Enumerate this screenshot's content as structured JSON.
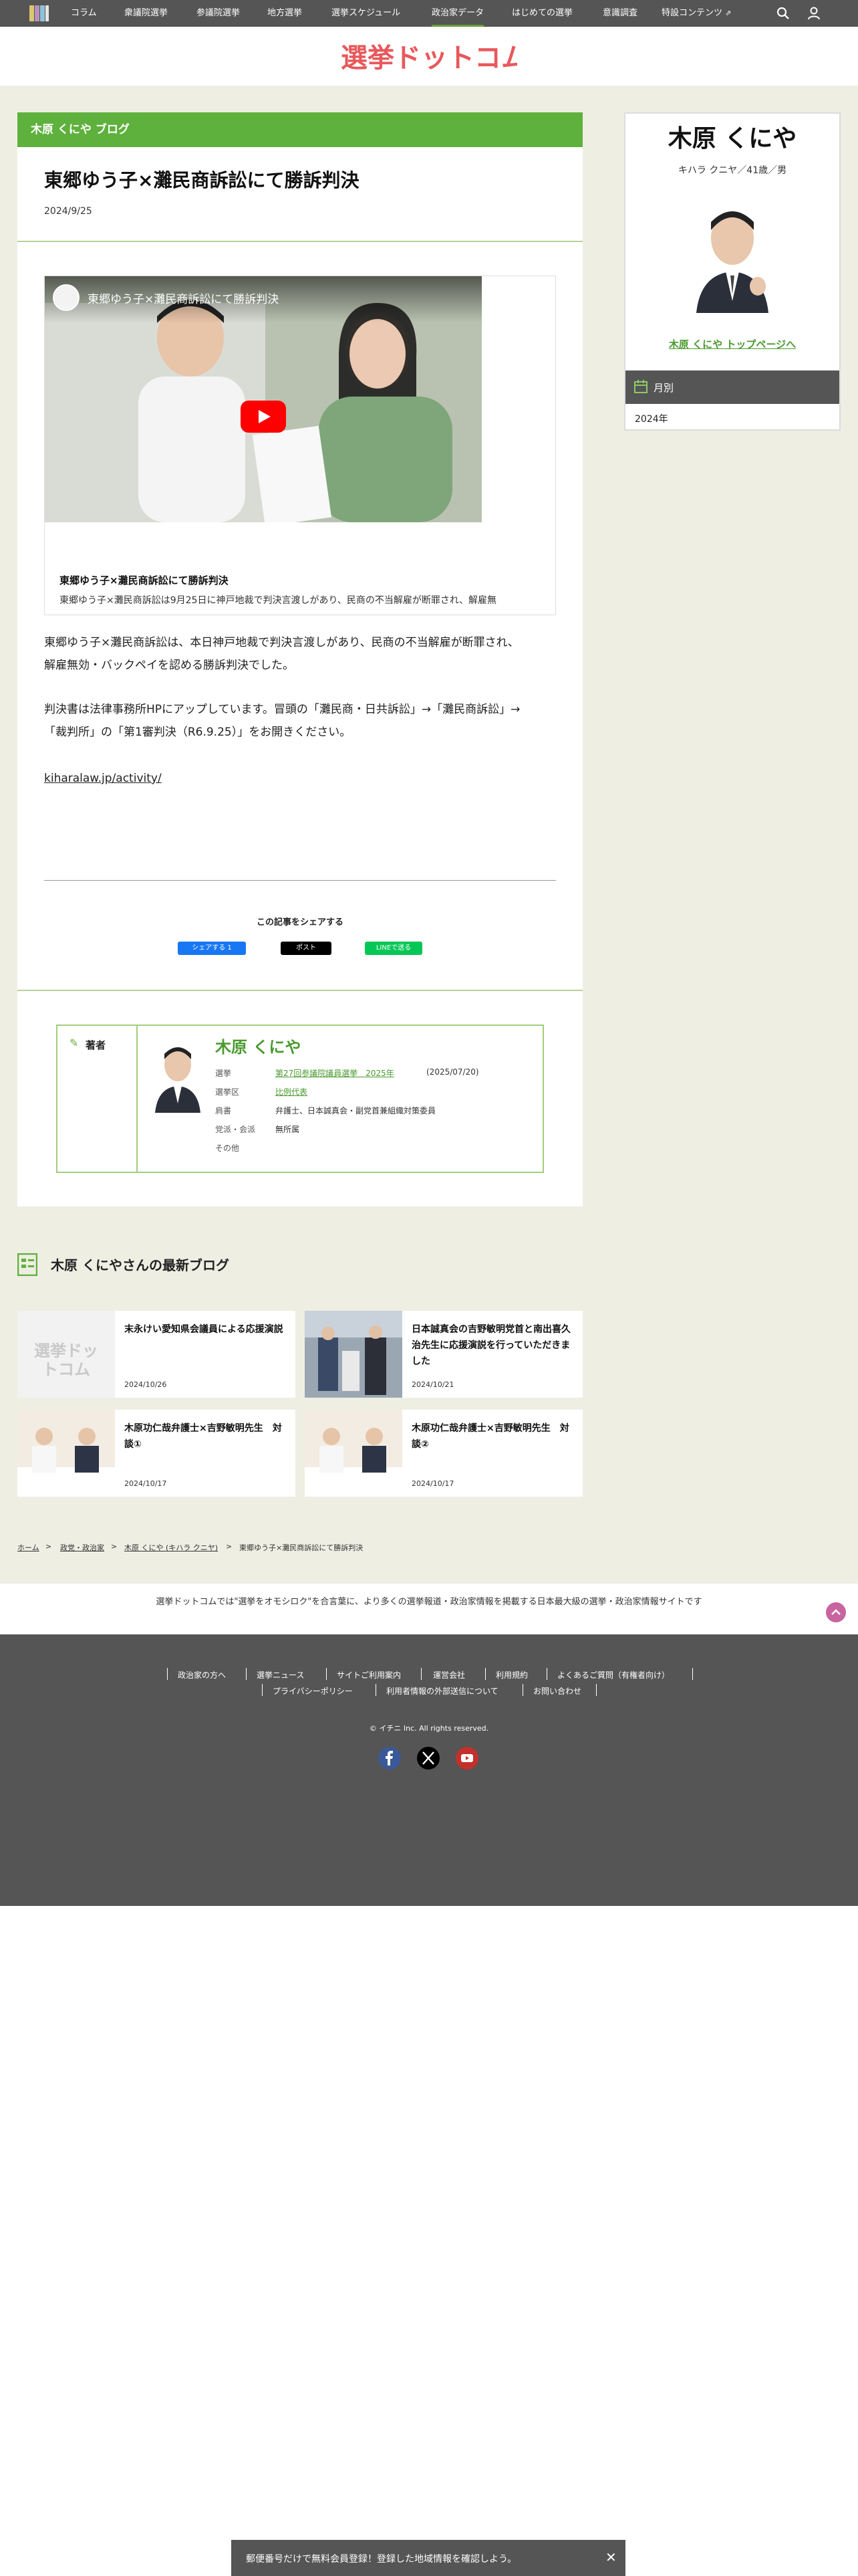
{
  "nav": {
    "items": [
      "コラム",
      "衆議院選挙",
      "参議院選挙",
      "地方選挙",
      "選挙スケジュール",
      "政治家データ",
      "はじめての選挙",
      "意識調査",
      "特設コンテンツ"
    ]
  },
  "logo": {
    "text": "選挙ドットコム"
  },
  "main": {
    "category_header": "木原 くにや ブログ",
    "title": "東郷ゆう子×灘民商訴訟にて勝訴判決",
    "date": "2024/9/25",
    "embed": {
      "video_title": "東郷ゆう子×灘民商訴訟にて勝訴判決",
      "title": "東郷ゆう子×灘民商訴訟にて勝訴判決",
      "description": "東郷ゆう子×灘民商訴訟は9月25日に神戸地裁で判決言渡しがあり、民商の不当解雇が断罪され、解雇無"
    },
    "body": [
      "東郷ゆう子×灘民商訴訟は、本日神戸地裁で判決言渡しがあり、民商の不当解雇が断罪され、",
      "解雇無効・バックペイを認める勝訴判決でした。",
      "判決書は法律事務所HPにアップしています。冒頭の「灘民商・日共訴訟」→「灘民商訴訟」→",
      "「裁判所」の「第1審判決（R6.9.25）」をお開きください。"
    ],
    "link": "kiharalaw.jp/activity/",
    "share": {
      "heading": "この記事をシェアする",
      "facebook": "シェアする 1",
      "x": "ポスト",
      "line": "LINEで送る"
    }
  },
  "author": {
    "label": "著者",
    "name": "木原 くにや",
    "rows": [
      {
        "key": "選挙",
        "value": "第27回参議院議員選挙　2025年",
        "extra": "(2025/07/20)"
      },
      {
        "key": "選挙区",
        "value": "比例代表"
      },
      {
        "key": "肩書",
        "value": "弁護士、日本誠真会・副党首兼組織対策委員"
      },
      {
        "key": "党派・会派",
        "value": "無所属"
      },
      {
        "key": "その他",
        "value": ""
      }
    ]
  },
  "recent": {
    "heading": "木原 くにやさんの最新ブログ",
    "cards": [
      {
        "title": "末永けい愛知県会議員による応援演説",
        "date": "2024/10/26",
        "thumb": "logo"
      },
      {
        "title": "日本誠真会の吉野敏明党首と南出喜久治先生に応援演説を行っていただきました",
        "date": "2024/10/21",
        "thumb": "street"
      },
      {
        "title": "木原功仁哉弁護士×吉野敏明先生　対談①",
        "date": "2024/10/17",
        "thumb": "talk"
      },
      {
        "title": "木原功仁哉弁護士×吉野敏明先生　対談②",
        "date": "2024/10/17",
        "thumb": "talk"
      }
    ]
  },
  "breadcrumb": [
    "ホーム",
    "政党・政治家",
    "木原 くにや (キハラ クニヤ)",
    "東郷ゆう子×灘民商訴訟にて勝訴判決"
  ],
  "sidebar": {
    "name": "木原 くにや",
    "kana": "キハラ クニヤ／41歳／男",
    "top_link": "木原 くにや トップページへ",
    "month_label": "月別",
    "year": "2024年"
  },
  "footer": {
    "tagline": "選挙ドットコムでは\"選挙をオモシロク\"を合言葉に、より多くの選挙報道・政治家情報を掲載する日本最大級の選挙・政治家情報サイトです",
    "links_row1": [
      "政治家の方へ",
      "選挙ニュース",
      "サイトご利用案内",
      "運営会社",
      "利用規約",
      "よくあるご質問（有権者向け）"
    ],
    "links_row2": [
      "プライバシーポリシー",
      "利用者情報の外部送信について",
      "お問い合わせ"
    ],
    "copyright": "© イチニ Inc. All rights reserved."
  },
  "banner": {
    "text": "郵便番号だけで無料会員登録！登録した地域情報を確認しよう。",
    "close": "✕"
  },
  "colors": {
    "accent_green": "#5fb13d",
    "dark_gray": "#555555",
    "band_beige": "#eeeee3"
  }
}
